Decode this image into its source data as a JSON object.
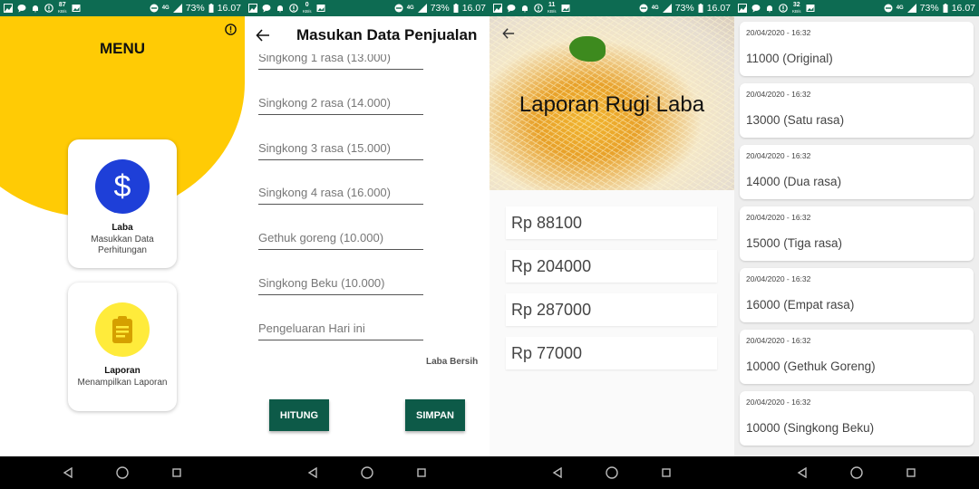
{
  "status_bars": [
    {
      "speed": "87",
      "speed_unit": "KB/s",
      "network": "4G",
      "battery": "73%",
      "time": "16.07"
    },
    {
      "speed": "0",
      "speed_unit": "KB/s",
      "network": "4G",
      "battery": "73%",
      "time": "16.07"
    },
    {
      "speed": "11",
      "speed_unit": "KB/s",
      "network": "4G",
      "battery": "73%",
      "time": "16.07"
    },
    {
      "speed": "32",
      "speed_unit": "KB/s",
      "network": "4G",
      "battery": "73%",
      "time": "16.07"
    }
  ],
  "menu_screen": {
    "title": "MENU",
    "cards": [
      {
        "icon": "dollar-icon",
        "title": "Laba",
        "subtitle": "Masukkan Data Perhitungan",
        "icon_color": "#1e3fd8"
      },
      {
        "icon": "clipboard-icon",
        "title": "Laporan",
        "subtitle": "Menampilkan Laporan",
        "icon_color": "#ffeb3b"
      }
    ],
    "accent_color": "#ffcb05"
  },
  "input_screen": {
    "title": "Masukan Data Penjualan",
    "fields": [
      "Singkong 1 rasa (13.000)",
      "Singkong 2 rasa (14.000)",
      "Singkong 3 rasa (15.000)",
      "Singkong 4 rasa (16.000)",
      "Gethuk goreng (10.000)",
      "Singkong Beku (10.000)",
      "Pengeluaran Hari ini"
    ],
    "result_label": "Laba Bersih",
    "hitung_label": "HITUNG",
    "simpan_label": "SIMPAN",
    "button_color": "#0d5a48"
  },
  "report_screen": {
    "title": "Laporan Rugi Laba",
    "values": [
      "Rp 88100",
      "Rp 204000",
      "Rp 287000",
      "Rp 77000"
    ]
  },
  "history_screen": {
    "items": [
      {
        "timestamp": "20/04/2020 - 16:32",
        "value": "11000 (Original)"
      },
      {
        "timestamp": "20/04/2020 - 16:32",
        "value": "13000 (Satu rasa)"
      },
      {
        "timestamp": "20/04/2020 - 16:32",
        "value": "14000 (Dua rasa)"
      },
      {
        "timestamp": "20/04/2020 - 16:32",
        "value": "15000 (Tiga rasa)"
      },
      {
        "timestamp": "20/04/2020 - 16:32",
        "value": "16000 (Empat rasa)"
      },
      {
        "timestamp": "20/04/2020 - 16:32",
        "value": "10000 (Gethuk Goreng)"
      },
      {
        "timestamp": "20/04/2020 - 16:32",
        "value": "10000 (Singkong Beku)"
      }
    ]
  },
  "colors": {
    "status_bar": "#0d6b52"
  }
}
